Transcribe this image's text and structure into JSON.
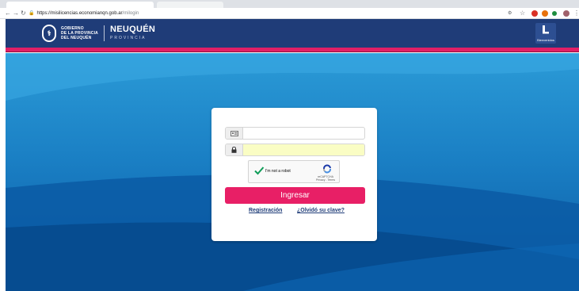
{
  "browser": {
    "url_host": "https://misilicencias.economianqn.gob.ar",
    "url_path": "/milogin"
  },
  "header": {
    "gov_line1": "GOBIERNO",
    "gov_line2": "DE LA PROVINCIA",
    "gov_line3": "DEL NEUQUÉN",
    "brand": "NEUQUÉN",
    "brand_sub": "PROVINCIA",
    "user_label": "Bienvenidos",
    "primary_color": "#1f3c78",
    "accent_color": "#e11f66"
  },
  "login": {
    "username_icon": "id-card-icon",
    "password_icon": "lock-icon",
    "username_value": "",
    "password_value": "",
    "recaptcha_label": "I'm not a robot",
    "recaptcha_brand": "reCAPTCHA",
    "recaptcha_terms": "Privacy - Terms",
    "submit_label": "Ingresar",
    "register_link": "Registración",
    "forgot_link": "¿Olvidó su clave?"
  }
}
